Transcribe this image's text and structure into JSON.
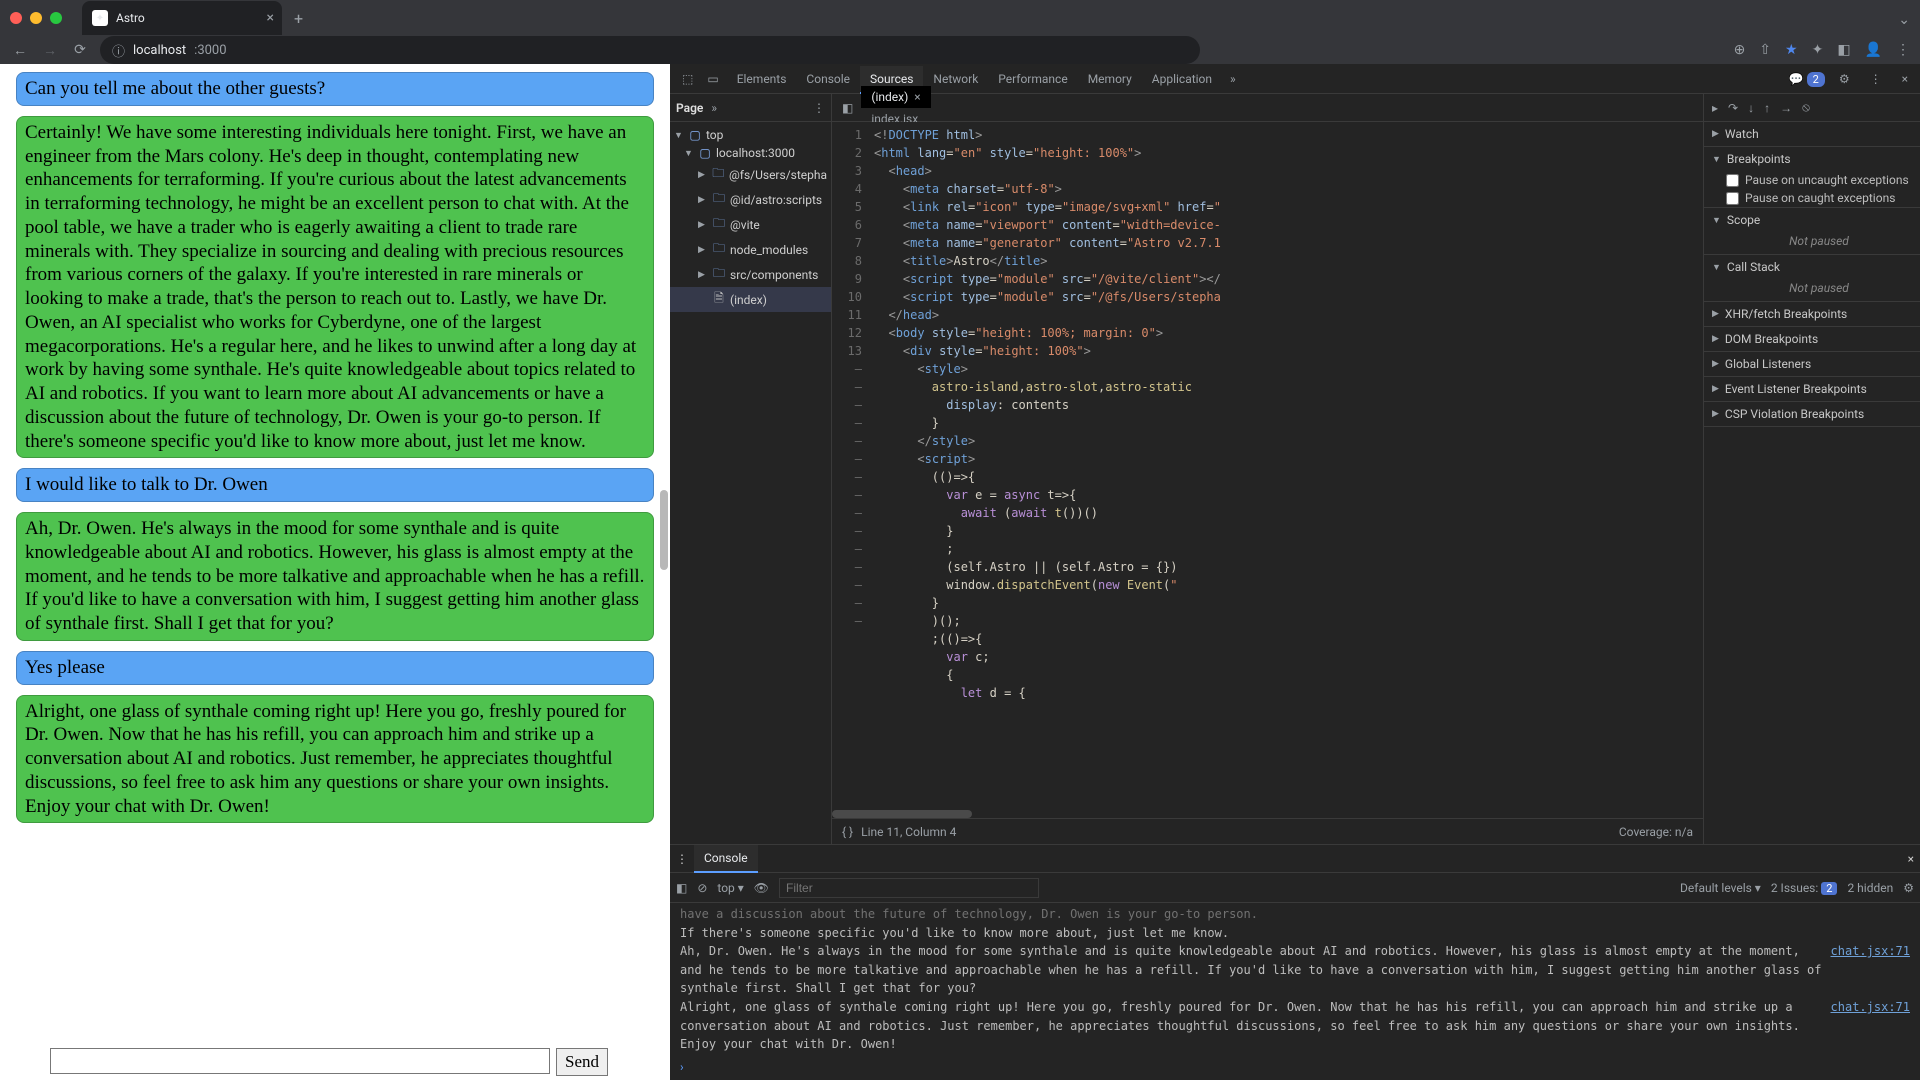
{
  "browser": {
    "tab_title": "Astro",
    "url_host": "localhost",
    "url_path": ":3000"
  },
  "chat": {
    "messages": [
      {
        "role": "user",
        "text": "Can you tell me about the other guests?"
      },
      {
        "role": "bot",
        "text": "Certainly! We have some interesting individuals here tonight. First, we have an engineer from the Mars colony. He's deep in thought, contemplating new enhancements for terraforming. If you're curious about the latest advancements in terraforming technology, he might be an excellent person to chat with. At the pool table, we have a trader who is eagerly awaiting a client to trade rare minerals with. They specialize in sourcing and dealing with precious resources from various corners of the galaxy. If you're interested in rare minerals or looking to make a trade, that's the person to reach out to. Lastly, we have Dr. Owen, an AI specialist who works for Cyberdyne, one of the largest megacorporations. He's a regular here, and he likes to unwind after a long day at work by having some synthale. He's quite knowledgeable about topics related to AI and robotics. If you want to learn more about AI advancements or have a discussion about the future of technology, Dr. Owen is your go-to person. If there's someone specific you'd like to know more about, just let me know."
      },
      {
        "role": "user",
        "text": "I would like to talk to Dr. Owen"
      },
      {
        "role": "bot",
        "text": "Ah, Dr. Owen. He's always in the mood for some synthale and is quite knowledgeable about AI and robotics. However, his glass is almost empty at the moment, and he tends to be more talkative and approachable when he has a refill. If you'd like to have a conversation with him, I suggest getting him another glass of synthale first. Shall I get that for you?"
      },
      {
        "role": "user",
        "text": "Yes please"
      },
      {
        "role": "bot",
        "text": "Alright, one glass of synthale coming right up! Here you go, freshly poured for Dr. Owen. Now that he has his refill, you can approach him and strike up a conversation about AI and robotics. Just remember, he appreciates thoughtful discussions, so feel free to ask him any questions or share your own insights. Enjoy your chat with Dr. Owen!"
      }
    ],
    "send_label": "Send",
    "input_value": ""
  },
  "devtools": {
    "tabs": [
      "Elements",
      "Console",
      "Sources",
      "Network",
      "Performance",
      "Memory",
      "Application"
    ],
    "active_tab": "Sources",
    "issue_count": "2",
    "nav": {
      "header": "Page",
      "tree": [
        {
          "depth": 0,
          "icon": "cloud",
          "label": "top",
          "expanded": true
        },
        {
          "depth": 1,
          "icon": "cloud",
          "label": "localhost:3000",
          "expanded": true
        },
        {
          "depth": 2,
          "icon": "folder",
          "label": "@fs/Users/stepha"
        },
        {
          "depth": 2,
          "icon": "folder",
          "label": "@id/astro:scripts"
        },
        {
          "depth": 2,
          "icon": "folder",
          "label": "@vite"
        },
        {
          "depth": 2,
          "icon": "folder",
          "label": "node_modules"
        },
        {
          "depth": 2,
          "icon": "folder",
          "label": "src/components"
        },
        {
          "depth": 2,
          "icon": "file",
          "label": "(index)",
          "selected": true
        }
      ]
    },
    "editor": {
      "tabs": [
        {
          "label": "(index)",
          "active": true
        },
        {
          "label": "index.jsx",
          "active": false
        }
      ],
      "status_left": "Line 11, Column 4",
      "status_right": "Coverage: n/a",
      "gutter": [
        "1",
        "2",
        "3",
        "4",
        "5",
        "6",
        "7",
        "8",
        "9",
        "10",
        "11",
        "12",
        "13",
        "–",
        "–",
        "–",
        "–",
        "–",
        "–",
        "–",
        "–",
        "–",
        "–",
        "–",
        "–",
        "–",
        "–",
        "–"
      ]
    },
    "debug": {
      "sections": {
        "watch": "Watch",
        "breakpoints": "Breakpoints",
        "pause_uncaught": "Pause on uncaught exceptions",
        "pause_caught": "Pause on caught exceptions",
        "scope": "Scope",
        "scope_body": "Not paused",
        "callstack": "Call Stack",
        "callstack_body": "Not paused",
        "xhr": "XHR/fetch Breakpoints",
        "dom": "DOM Breakpoints",
        "global": "Global Listeners",
        "event": "Event Listener Breakpoints",
        "csp": "CSP Violation Breakpoints"
      }
    },
    "console": {
      "title": "Console",
      "context": "top",
      "filter_placeholder": "Filter",
      "levels": "Default levels",
      "issues_label": "2 Issues:",
      "issues_count": "2",
      "hidden": "2 hidden",
      "lines": [
        {
          "text": "have a discussion about the future of technology, Dr. Owen is your go-to person.",
          "src": "",
          "dim": true
        },
        {
          "text": "",
          "src": ""
        },
        {
          "text": "If there's someone specific you'd like to know more about, just let me know.",
          "src": ""
        },
        {
          "text": "Ah, Dr. Owen. He's always in the mood for some synthale and is quite knowledgeable about AI and robotics. However, his glass is almost empty at the moment, and he tends to be more talkative and approachable when he has a refill. If you'd like to have a conversation with him, I suggest getting him another glass of synthale first. Shall I get that for you?",
          "src": "chat.jsx:71"
        },
        {
          "text": "Alright, one glass of synthale coming right up! Here you go, freshly poured for Dr. Owen. Now that he has his refill, you can approach him and strike up a conversation about AI and robotics. Just remember, he appreciates thoughtful discussions, so feel free to ask him any questions or share your own insights. Enjoy your chat with Dr. Owen!",
          "src": "chat.jsx:71"
        }
      ]
    }
  }
}
